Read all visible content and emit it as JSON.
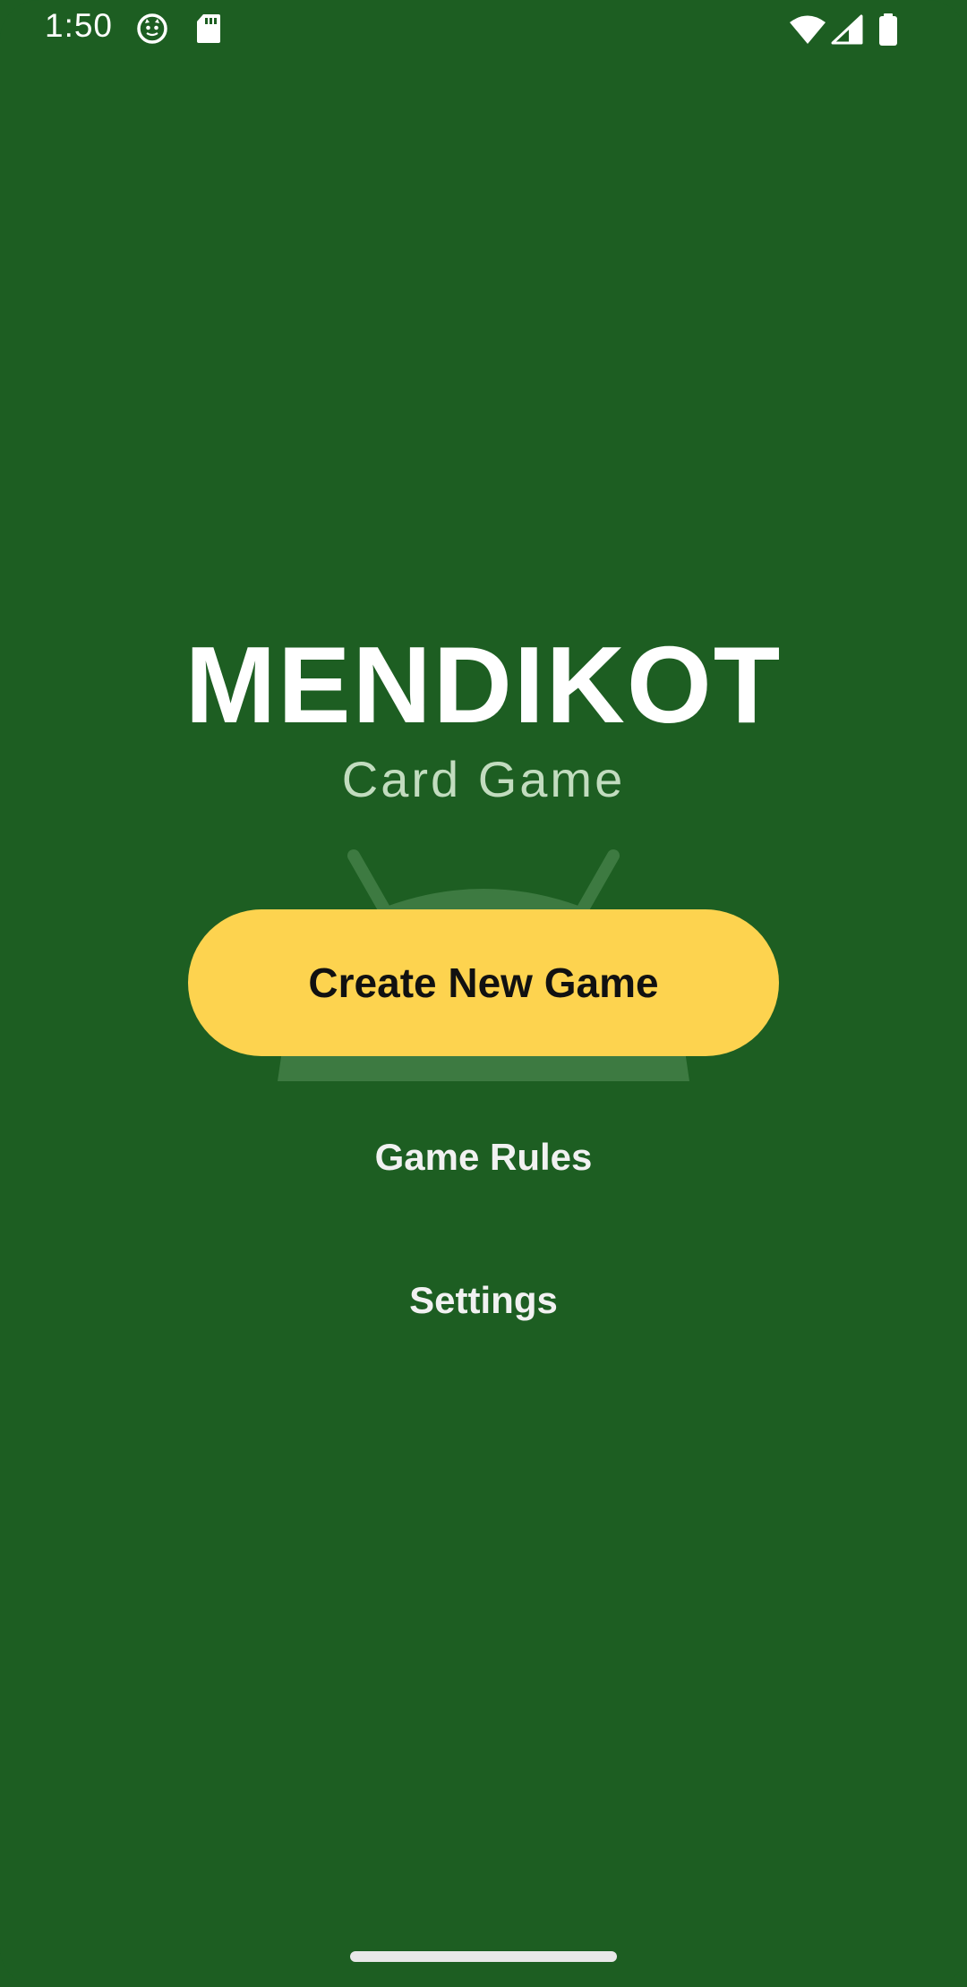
{
  "status_bar": {
    "time": "1:50",
    "left_icons": [
      "cat-face-icon",
      "sd-card-icon"
    ],
    "right_icons": [
      "wifi-icon",
      "cellular-signal-icon",
      "battery-icon"
    ]
  },
  "app": {
    "title": "MENDIKOT",
    "subtitle": "Card Game"
  },
  "menu": {
    "create_label": "Create New Game",
    "rules_label": "Game Rules",
    "settings_label": "Settings"
  },
  "colors": {
    "background": "#1d5e22",
    "accent": "#fdd34f",
    "subtitle": "#c2dcbf"
  }
}
